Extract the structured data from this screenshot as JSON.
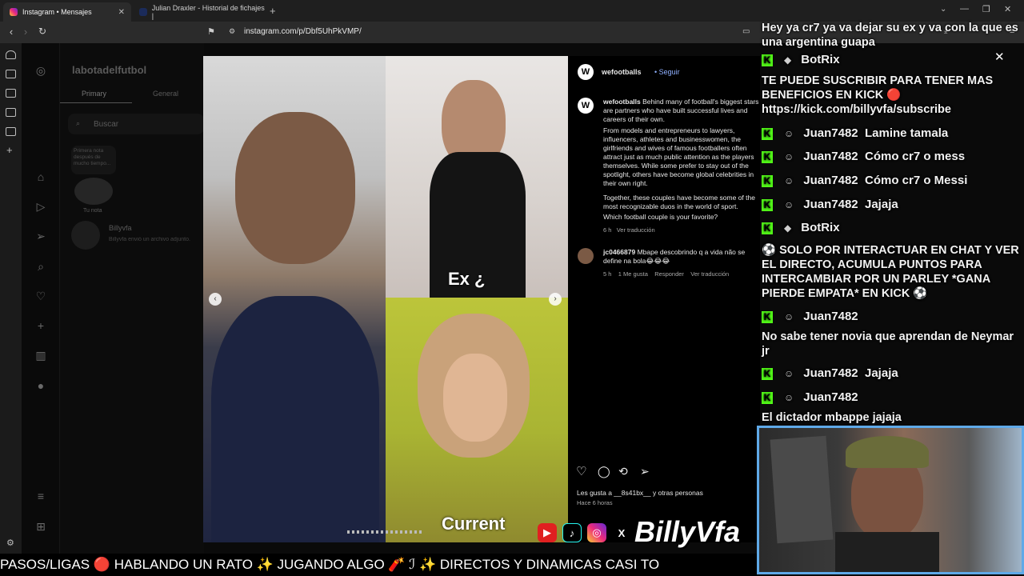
{
  "browser": {
    "tabs": [
      {
        "label": "Instagram • Mensajes",
        "active": true
      },
      {
        "label": "Julian Draxler - Historial de fichajes |",
        "active": false
      }
    ],
    "url": "instagram.com/p/Dbf5UhPkVMP/"
  },
  "instagram": {
    "account": "labotadelfutbol",
    "tabs": [
      "Primary",
      "General"
    ],
    "search_placeholder": "Buscar",
    "note_text": "Primera nota después de mucho tiempo...",
    "note_label": "Tu nota",
    "conversation": {
      "name": "Billyvfa",
      "preview": "Billyvfa envió un archivo adjunto."
    }
  },
  "post": {
    "account": "wefootballs",
    "follow_label": "Seguir",
    "caption_user": "wefootballs",
    "caption_p1": "Behind many of football's biggest stars are partners who have built successful lives and careers of their own.",
    "caption_p2": "From models and entrepreneurs to lawyers, influencers, athletes and businesswomen, the girlfriends and wives of famous footballers often attract just as much public attention as the players themselves. While some prefer to stay out of the spotlight, others have become global celebrities in their own right.",
    "caption_p3": "Together, these couples have become some of the most recognizable duos in the world of sport.",
    "caption_p4": "Which football couple is your favorite?",
    "caption_time": "6 h",
    "caption_translate": "Ver traducción",
    "comment": {
      "user": "jc0466879",
      "text": "Mbape descobrindo q a vida não se define na bola😂😂😂",
      "time": "5 h",
      "likes": "1 Me gusta",
      "reply": "Responder",
      "translate": "Ver traducción"
    },
    "likes_text": "Les gusta a __8s41bx__ y otras personas",
    "posted": "Hace 6 horas",
    "image_labels": {
      "ex": "Ex ¿",
      "current": "Current"
    }
  },
  "chat": [
    {
      "type": "text",
      "text": "Hey ya cr7 ya va dejar su ex y va con la que es una argentina guapa"
    },
    {
      "type": "user",
      "badge": "K",
      "icon": "diamond-icon",
      "user": "BotRix",
      "msg": ""
    },
    {
      "type": "text",
      "text": "TE PUEDE SUSCRIBIR PARA TENER MAS BENEFICIOS EN KICK 🔴 https://kick.com/billyvfa/subscribe"
    },
    {
      "type": "user",
      "badge": "K",
      "icon": "user-icon",
      "user": "Juan7482",
      "msg": "Lamine tamala"
    },
    {
      "type": "user",
      "badge": "K",
      "icon": "user-icon",
      "user": "Juan7482",
      "msg": "Cómo cr7 o mess"
    },
    {
      "type": "user",
      "badge": "K",
      "icon": "user-icon",
      "user": "Juan7482",
      "msg": "Cómo cr7 o Messi"
    },
    {
      "type": "user",
      "badge": "K",
      "icon": "user-icon",
      "user": "Juan7482",
      "msg": "Jajaja"
    },
    {
      "type": "user",
      "badge": "K",
      "icon": "diamond-icon",
      "user": "BotRix",
      "msg": ""
    },
    {
      "type": "text",
      "text": "⚽ SOLO POR INTERACTUAR EN CHAT Y VER EL DIRECTO, ACUMULA PUNTOS PARA INTERCAMBIAR POR UN PARLEY *GANA PIERDE EMPATA* EN KICK ⚽"
    },
    {
      "type": "user",
      "badge": "K",
      "icon": "user-icon",
      "user": "Juan7482",
      "msg": ""
    },
    {
      "type": "text",
      "text": "No sabe tener novia que aprendan de Neymar jr"
    },
    {
      "type": "user",
      "badge": "K",
      "icon": "user-icon",
      "user": "Juan7482",
      "msg": "Jajaja"
    },
    {
      "type": "user",
      "badge": "K",
      "icon": "user-icon",
      "user": "Juan7482",
      "msg": ""
    },
    {
      "type": "text",
      "text": "El dictador mbappe jajaja"
    }
  ],
  "overlay": {
    "brand": "BillyVfa",
    "ticker": "PASOS/LIGAS 🔴 HABLANDO UN RATO ✨ JUGANDO ALGO 🧨        ℐ        ✨ DIRECTOS Y DINAMICAS CASI TO"
  },
  "colors": {
    "kick": "#53fc18",
    "ig_blue": "#8fb0ff",
    "webcam_border": "#5fa9e8"
  }
}
